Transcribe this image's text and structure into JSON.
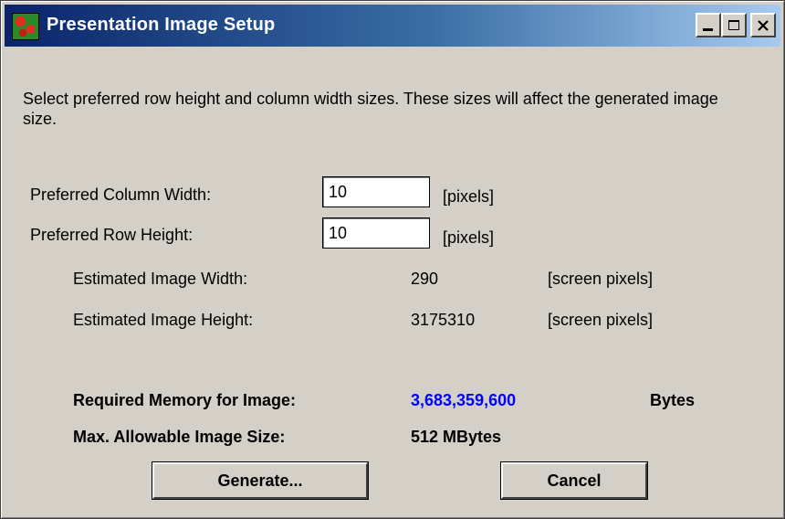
{
  "window": {
    "title": "Presentation Image Setup",
    "icon": "app-icon"
  },
  "description": "Select preferred row height  and column width sizes. These sizes will affect the generated image size.",
  "column_width": {
    "label": "Preferred Column Width:",
    "value": "10",
    "unit": "[pixels]"
  },
  "row_height": {
    "label": "Preferred Row Height:",
    "value": "10",
    "unit": "[pixels]"
  },
  "estimated_width": {
    "label": "Estimated Image Width:",
    "value": "290",
    "unit": "[screen pixels]"
  },
  "estimated_height": {
    "label": "Estimated Image Height:",
    "value": "3175310",
    "unit": "[screen pixels]"
  },
  "memory": {
    "label": "Required Memory for Image:",
    "value": "3,683,359,600",
    "unit": "Bytes",
    "value_color": "#0000ff"
  },
  "max_size": {
    "label": "Max. Allowable Image Size:",
    "value": "512 MBytes"
  },
  "buttons": {
    "generate": "Generate...",
    "cancel": "Cancel"
  }
}
